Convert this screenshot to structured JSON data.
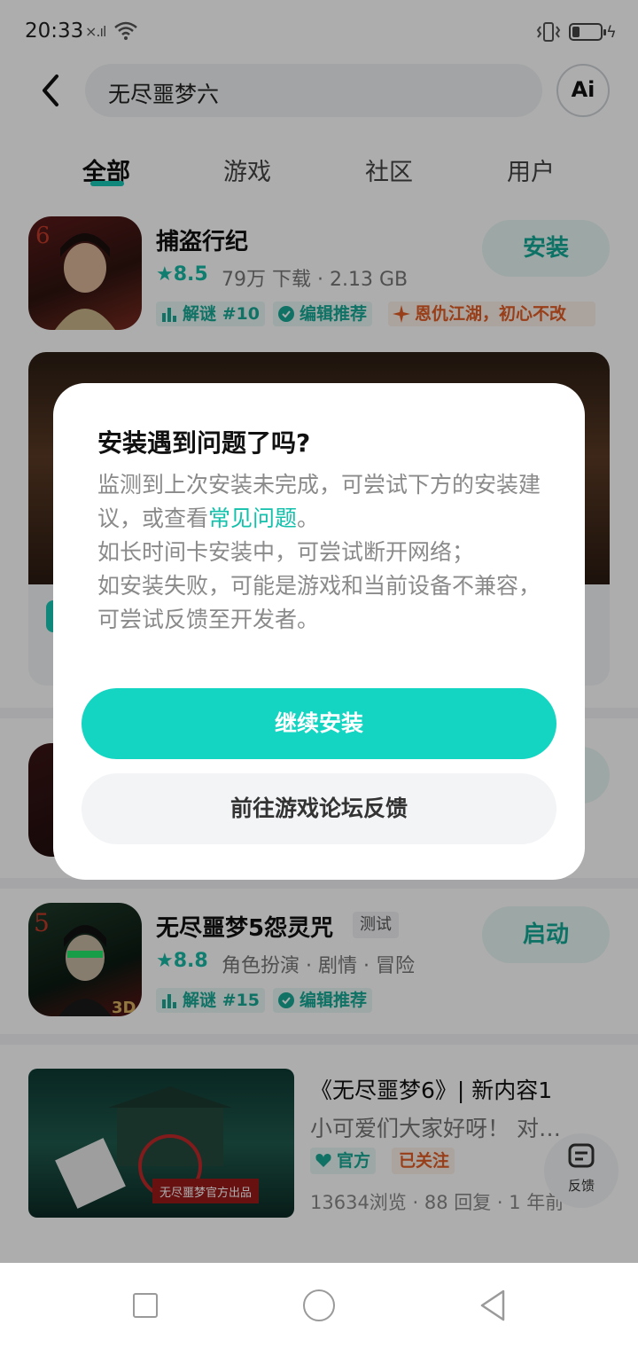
{
  "status_bar": {
    "time": "20:33",
    "signal": "×.ıl"
  },
  "search": {
    "query": "无尽噩梦六",
    "ai_label": "Ai"
  },
  "tabs": [
    {
      "label": "全部"
    },
    {
      "label": "游戏"
    },
    {
      "label": "社区"
    },
    {
      "label": "用户"
    }
  ],
  "results": {
    "game1": {
      "title": "捕盗行纪",
      "rating": "8.5",
      "meta": "79万 下载 · 2.13 GB",
      "tags": [
        "解谜 #10",
        "编辑推荐",
        "恩仇江湖，初心不改"
      ],
      "action": "安装"
    },
    "game2": {
      "title": "无尽噩梦5怨灵咒",
      "badge": "测试",
      "rating": "8.8",
      "meta": "角色扮演 · 剧情 · 冒险",
      "tags": [
        "解谜 #15",
        "编辑推荐"
      ],
      "action": "启动"
    },
    "post": {
      "title": "《无尽噩梦6》| 新内容1",
      "snippet": "小可爱们大家好呀！ 对…",
      "tags": [
        "官方",
        "已关注"
      ],
      "stats": "13634浏览 · 88 回复 · 1 年前",
      "image_caption": "无尽噩梦官方出品"
    }
  },
  "float_feedback": {
    "label": "反馈"
  },
  "dialog": {
    "title": "安装遇到问题了吗?",
    "body_part1": "监测到上次安装未完成，可尝试下方的安装建议，或查看",
    "body_link": "常见问题",
    "body_part2": "。",
    "body_line2": "如长时间卡安装中，可尝试断开网络；",
    "body_line3": "如安装失败，可能是游戏和当前设备不兼容，可尝试反馈至开发者。",
    "primary_button": "继续安装",
    "secondary_button": "前往游戏论坛反馈"
  },
  "colors": {
    "accent": "#14d4c2",
    "link": "#13c0ab",
    "tag_orange": "#e05c25"
  }
}
